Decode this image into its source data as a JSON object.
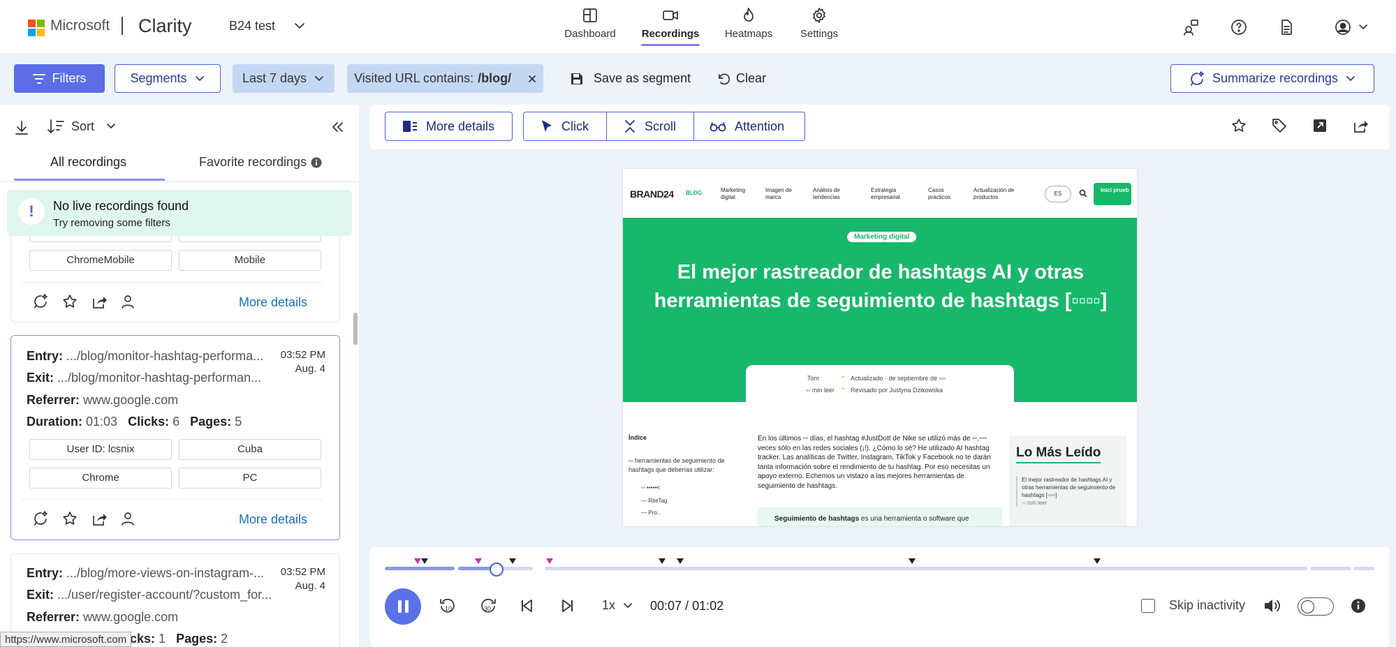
{
  "header": {
    "brand": "Microsoft",
    "app_name": "Clarity",
    "project": "B24 test",
    "nav": [
      {
        "label": "Dashboard",
        "icon": "dashboard-icon"
      },
      {
        "label": "Recordings",
        "icon": "video-camera-icon",
        "active": true
      },
      {
        "label": "Heatmaps",
        "icon": "flame-icon"
      },
      {
        "label": "Settings",
        "icon": "gear-icon"
      }
    ],
    "right_icons": [
      "share-users-icon",
      "help-icon",
      "document-icon",
      "account-icon"
    ]
  },
  "filterbar": {
    "filters_label": "Filters",
    "segments_label": "Segments",
    "date_range": "Last 7 days",
    "url_filter_prefix": "Visited URL contains:",
    "url_filter_value": "/blog/",
    "save_segment_label": "Save as segment",
    "clear_label": "Clear",
    "summarize_label": "Summarize recordings"
  },
  "sidebar": {
    "sort_label": "Sort",
    "tabs": [
      {
        "label": "All recordings",
        "active": true
      },
      {
        "label": "Favorite recordings"
      }
    ],
    "live_banner": {
      "title": "No live recordings found",
      "subtitle": "Try removing some filters"
    },
    "card_partial": {
      "tags": [
        "ChromeMobile",
        "Mobile"
      ],
      "more_details": "More details"
    },
    "card_selected": {
      "entry_label": "Entry:",
      "entry": ".../blog/monitor-hashtag-performa...",
      "exit_label": "Exit:",
      "exit": ".../blog/monitor-hashtag-performan...",
      "referrer_label": "Referrer:",
      "referrer": "www.google.com",
      "duration_label": "Duration:",
      "duration": "01:03",
      "clicks_label": "Clicks:",
      "clicks": "6",
      "pages_label": "Pages:",
      "pages": "5",
      "time": "03:52 PM",
      "date": "Aug. 4",
      "tags": [
        "User ID: lcsnix",
        "Cuba",
        "Chrome",
        "PC"
      ],
      "more_details": "More details"
    },
    "card_next": {
      "entry_label": "Entry:",
      "entry": ".../blog/more-views-on-instagram-...",
      "exit_label": "Exit:",
      "exit": ".../user/register-account/?custom_for...",
      "referrer_label": "Referrer:",
      "referrer": "www.google.com",
      "clicks_label": "cks:",
      "clicks": "1",
      "pages_label": "Pages:",
      "pages": "2",
      "time": "03:52 PM",
      "date": "Aug. 4"
    },
    "status_url": "https://www.microsoft.com"
  },
  "viewer": {
    "more_details_label": "More details",
    "click_label": "Click",
    "scroll_label": "Scroll",
    "attention_label": "Attention",
    "right_icons": [
      "star-icon",
      "tag-icon",
      "open-external-icon",
      "share-icon"
    ]
  },
  "preview": {
    "logo": "BRAND24",
    "blog_tag": "BLOG",
    "menu": [
      "Marketing digital",
      "Imagen de marca",
      "Análisis de tendencias",
      "Estrategia empresarial",
      "Casos prácticos",
      "Actualización de productos"
    ],
    "lang": "ES",
    "cta": "Inici prueb",
    "category_pill": "Marketing digital",
    "headline": "El mejor rastreador de hashtags AI y otras herramientas de seguimiento de hashtags [▫▫▫▫]",
    "meta_author": "Tom",
    "meta_updated": "Actualizado · de septiembre de ▫▫▫",
    "meta_read": "▫▫ min leer",
    "meta_reviewer": "Revisado por Justyna Dzikowska",
    "toc_title": "Índice",
    "toc_text": "▫▫ herramientas de seguimiento de hashtags que deberías utilizar:",
    "toc_items": [
      "▫▫ ▪▪▪▪▪▪:",
      "— RiteTag",
      "— Pro..."
    ],
    "body_text": "En los últimos ▫▫ días, el hashtag #JustDoIt de Nike se utilizó más de ▫▫,▫▫▫ veces sólo en las redes sociales (¡!). ¿Cómo lo sé? He utilizado AI hashtag tracker. Las analíticas de Twitter, Instagram, TikTok y Facebook no te darán tanta información sobre el rendimiento de tu hashtag. Por eso necesitas un apoyo externo. Echemos un vistazo a las mejores herramientas de seguimiento de hashtags.",
    "box_bold": "Seguimiento de hashtags",
    "box_text": " es una herramienta o software que",
    "sidebar_title": "Lo Más Leído",
    "sidebar_text": "El mejor rastreador de hashtags AI y otras herramientas de seguimiento de hashtags [▫▫▫▫]",
    "sidebar_read": "▫▫ min leer"
  },
  "player": {
    "current_time": "00:07",
    "total_time": "01:02",
    "progress": 0.113,
    "speed": "1x",
    "skip_inactivity_label": "Skip inactivity",
    "skip_inactivity_checked": false,
    "colors": {
      "accent": "#5a72e8",
      "track_played": "#8d97e6",
      "track_rest": "#d6d8f4",
      "marker_pink": "#d42bb0"
    }
  }
}
